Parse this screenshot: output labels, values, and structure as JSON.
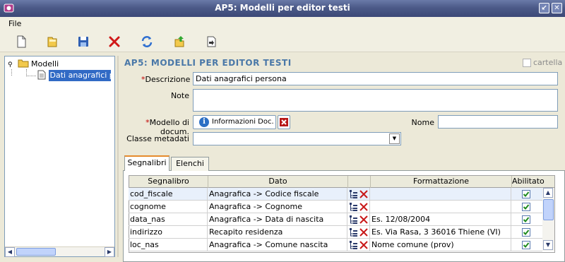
{
  "window": {
    "title": "AP5: Modelli per editor testi"
  },
  "menu": {
    "file": "File"
  },
  "toolbar": {
    "icons": [
      "new-document-icon",
      "open-folder-icon",
      "save-icon",
      "delete-icon",
      "refresh-icon",
      "export-icon",
      "import-icon"
    ]
  },
  "tree": {
    "root_label": "Modelli",
    "child_label": "Dati anagrafici persona"
  },
  "form": {
    "title": "AP5: MODELLI PER EDITOR TESTI",
    "cartella_label": "cartella",
    "descrizione_label": "Descrizione",
    "descrizione_value": "Dati anagrafici persona",
    "note_label": "Note",
    "note_value": "",
    "modello_label": "Modello di docum.",
    "informazioni_btn": "Informazioni Doc.",
    "nome_label": "Nome",
    "nome_value": "",
    "classe_label": "Classe metadati",
    "classe_value": ""
  },
  "tabs": [
    {
      "label": "Segnalibri",
      "active": true
    },
    {
      "label": "Elenchi",
      "active": false
    }
  ],
  "grid": {
    "headers": [
      "Segnalibro",
      "Dato",
      "",
      "Formattazione",
      "Abilitato"
    ],
    "rows": [
      {
        "segnalibro": "cod_fiscale",
        "dato": "Anagrafica -> Codice fiscale",
        "formattazione": "",
        "abilitato": true
      },
      {
        "segnalibro": "cognome",
        "dato": "Anagrafica -> Cognome",
        "formattazione": "",
        "abilitato": true
      },
      {
        "segnalibro": "data_nas",
        "dato": "Anagrafica -> Data di nascita",
        "formattazione": "Es. 12/08/2004",
        "abilitato": true
      },
      {
        "segnalibro": "indirizzo",
        "dato": "Recapito residenza",
        "formattazione": "Es. Via Rasa, 3 36016 Thiene (VI)",
        "abilitato": true
      },
      {
        "segnalibro": "loc_nas",
        "dato": "Anagrafica -> Comune nascita",
        "formattazione": "Nome comune (prov)",
        "abilitato": true
      }
    ]
  },
  "colors": {
    "title_accent": "#4a78a8",
    "required": "#c00000",
    "selection": "#316ac5"
  }
}
